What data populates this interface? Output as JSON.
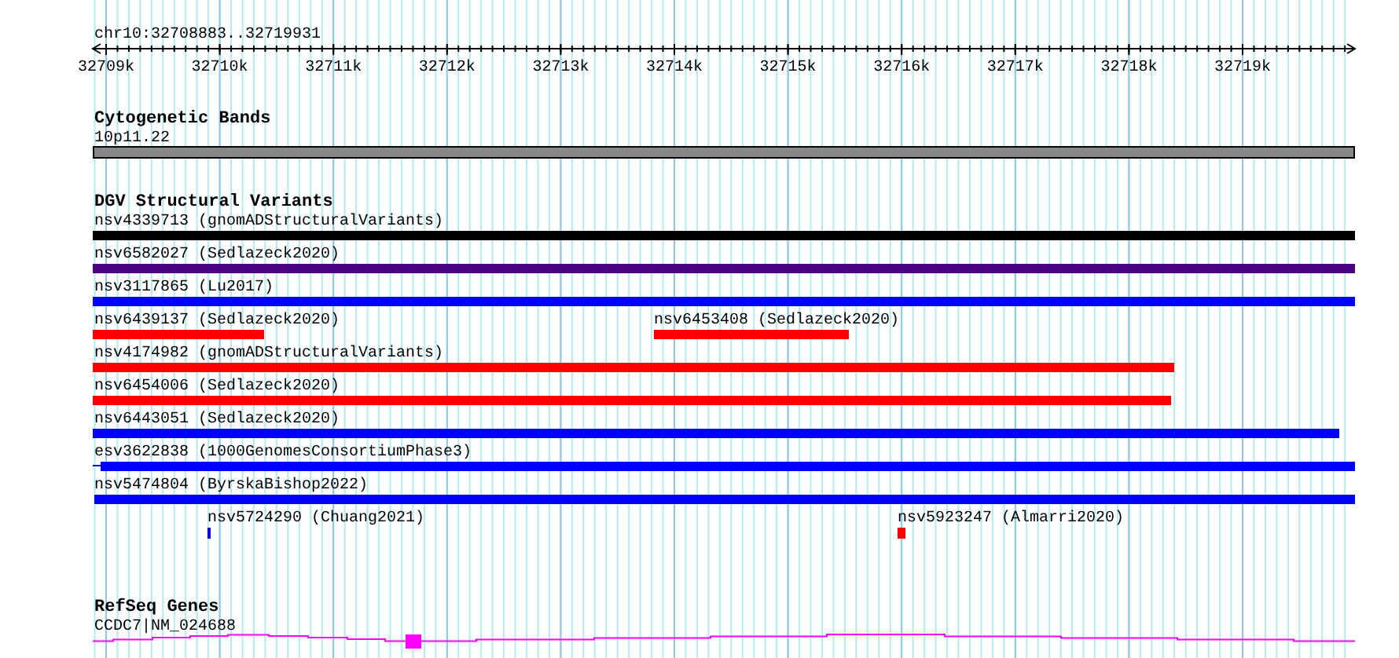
{
  "locus": "chr10:32708883..32719931",
  "ruler": {
    "ticks": [
      "32709k",
      "32710k",
      "32711k",
      "32712k",
      "32713k",
      "32714k",
      "32715k",
      "32716k",
      "32717k",
      "32718k",
      "32719k"
    ]
  },
  "tracks": [
    {
      "kind": "cytoband",
      "title": "Cytogenetic Bands",
      "rows": [
        {
          "items": [
            {
              "label": "10p11.22",
              "color": "#888888"
            }
          ]
        }
      ]
    },
    {
      "kind": "variants",
      "title": "DGV Structural Variants",
      "rows": [
        {
          "items": [
            {
              "label": "nsv4339713 (gnomADStructuralVariants)",
              "color": "#000000"
            }
          ]
        },
        {
          "items": [
            {
              "label": "nsv6582027 (Sedlazeck2020)",
              "color": "#4b0082"
            }
          ]
        },
        {
          "items": [
            {
              "label": "nsv3117865 (Lu2017)",
              "color": "#0000ff"
            }
          ]
        },
        {
          "items": [
            {
              "label": "nsv6439137 (Sedlazeck2020)",
              "color": "#ff0000"
            },
            {
              "label": "nsv6453408 (Sedlazeck2020)",
              "color": "#ff0000"
            }
          ]
        },
        {
          "items": [
            {
              "label": "nsv4174982 (gnomADStructuralVariants)",
              "color": "#ff0000"
            }
          ]
        },
        {
          "items": [
            {
              "label": "nsv6454006 (Sedlazeck2020)",
              "color": "#ff0000"
            }
          ]
        },
        {
          "items": [
            {
              "label": "nsv6443051 (Sedlazeck2020)",
              "color": "#0000ff"
            }
          ]
        },
        {
          "items": [
            {
              "label": "esv3622838 (1000GenomesConsortiumPhase3)",
              "color": "#0000ff"
            }
          ]
        },
        {
          "items": [
            {
              "label": "nsv5474804 (ByrskaBishop2022)",
              "color": "#0000ff"
            }
          ]
        },
        {
          "items": [
            {
              "label": "nsv5724290 (Chuang2021)",
              "color": "#0000ff"
            },
            {
              "label": "nsv5923247 (Almarri2020)",
              "color": "#ff0000"
            }
          ]
        }
      ]
    },
    {
      "kind": "genes",
      "title": "RefSeq Genes",
      "rows": [
        {
          "items": [
            {
              "label": "CCDC7|NM_024688",
              "color": "#ff00ff"
            }
          ]
        }
      ]
    }
  ]
}
